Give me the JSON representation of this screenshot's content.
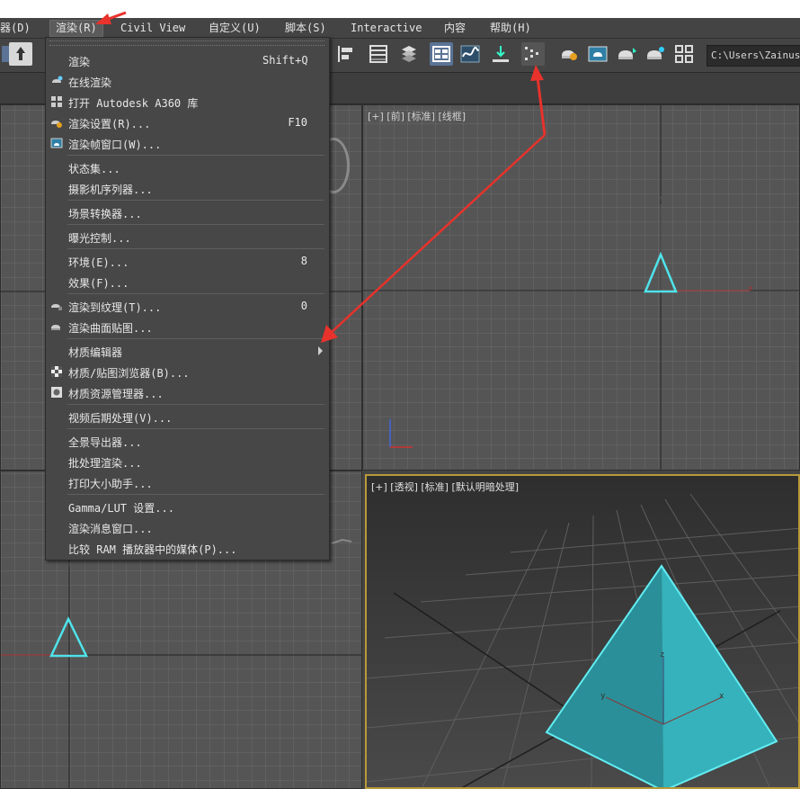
{
  "menubar": {
    "items": [
      {
        "label": "器(D)"
      },
      {
        "label": "渲染(R)"
      },
      {
        "label": "Civil View"
      },
      {
        "label": "自定义(U)"
      },
      {
        "label": "脚本(S)"
      },
      {
        "label": "Interactive"
      },
      {
        "label": "内容"
      },
      {
        "label": "帮助(H)"
      }
    ]
  },
  "toolbar": {
    "path_text": "C:\\Users\\Zainus_"
  },
  "viewports": {
    "front_label": "[+] [前] [标准] [线框]",
    "persp_label": "[+] [透视] [标准] [默认明暗处理]",
    "axis_x": "x",
    "axis_z": "z",
    "axis_y": "y"
  },
  "render_menu": {
    "items": [
      {
        "label": "渲染",
        "shortcut": "Shift+Q"
      },
      {
        "label": "在线渲染",
        "shortcut": ""
      },
      {
        "label": "打开 Autodesk A360 库",
        "shortcut": ""
      },
      {
        "label": "渲染设置(R)...",
        "shortcut": "F10"
      },
      {
        "label": "渲染帧窗口(W)...",
        "shortcut": ""
      },
      {
        "label": "状态集...",
        "shortcut": ""
      },
      {
        "label": "摄影机序列器...",
        "shortcut": ""
      },
      {
        "label": "场景转换器...",
        "shortcut": ""
      },
      {
        "label": "曝光控制...",
        "shortcut": ""
      },
      {
        "label": "环境(E)...",
        "shortcut": "8"
      },
      {
        "label": "效果(F)...",
        "shortcut": ""
      },
      {
        "label": "渲染到纹理(T)...",
        "shortcut": "0"
      },
      {
        "label": "渲染曲面贴图...",
        "shortcut": ""
      },
      {
        "label": "材质编辑器",
        "shortcut": ""
      },
      {
        "label": "材质/贴图浏览器(B)...",
        "shortcut": ""
      },
      {
        "label": "材质资源管理器...",
        "shortcut": ""
      },
      {
        "label": "视频后期处理(V)...",
        "shortcut": ""
      },
      {
        "label": "全景导出器...",
        "shortcut": ""
      },
      {
        "label": "批处理渲染...",
        "shortcut": ""
      },
      {
        "label": "打印大小助手...",
        "shortcut": ""
      },
      {
        "label": "Gamma/LUT 设置...",
        "shortcut": ""
      },
      {
        "label": "渲染消息窗口...",
        "shortcut": ""
      },
      {
        "label": "比较 RAM 播放器中的媒体(P)...",
        "shortcut": ""
      }
    ]
  },
  "colors": {
    "accent_selection": "#5a7396",
    "annotation_arrow": "#e8322b",
    "object_cyan": "#4fe3ea",
    "persp_fill": "#2aa6ad"
  }
}
